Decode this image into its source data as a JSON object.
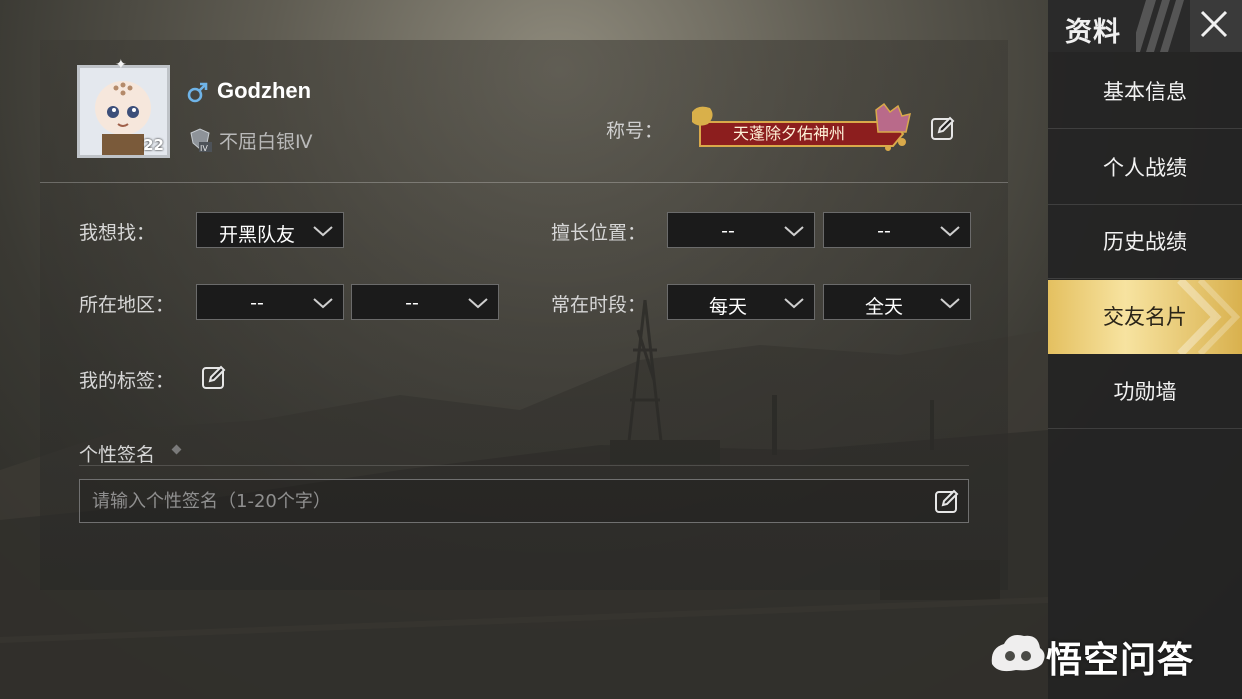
{
  "profile": {
    "username": "Godzhen",
    "level": "22",
    "rank": "不屈白银Ⅳ",
    "title_label": "称号：",
    "title_name": "天蓬除夕佑神州"
  },
  "form": {
    "looking_for": {
      "label": "我想找：",
      "value": "开黑队友"
    },
    "position": {
      "label": "擅长位置：",
      "value1": "--",
      "value2": "--"
    },
    "region": {
      "label": "所在地区：",
      "value1": "--",
      "value2": "--"
    },
    "time": {
      "label": "常在时段：",
      "value1": "每天",
      "value2": "全天"
    },
    "tags": {
      "label": "我的标签："
    },
    "signature": {
      "label": "个性签名",
      "placeholder": "请输入个性签名（1-20个字）"
    }
  },
  "sidebar": {
    "title": "资料",
    "items": [
      {
        "label": "基本信息",
        "active": false
      },
      {
        "label": "个人战绩",
        "active": false
      },
      {
        "label": "历史战绩",
        "active": false
      },
      {
        "label": "交友名片",
        "active": true
      },
      {
        "label": "功勋墙",
        "active": false
      }
    ]
  },
  "watermark": {
    "text": "悟空问答"
  },
  "colors": {
    "accent_gold": "#e9c96a",
    "gender_blue": "#6fb4e8",
    "banner_red": "#8c1e1e"
  },
  "icons": [
    "male-icon",
    "rank-badge-icon",
    "edit-icon",
    "chevron-down-icon",
    "close-icon",
    "wukong-logo-icon"
  ]
}
